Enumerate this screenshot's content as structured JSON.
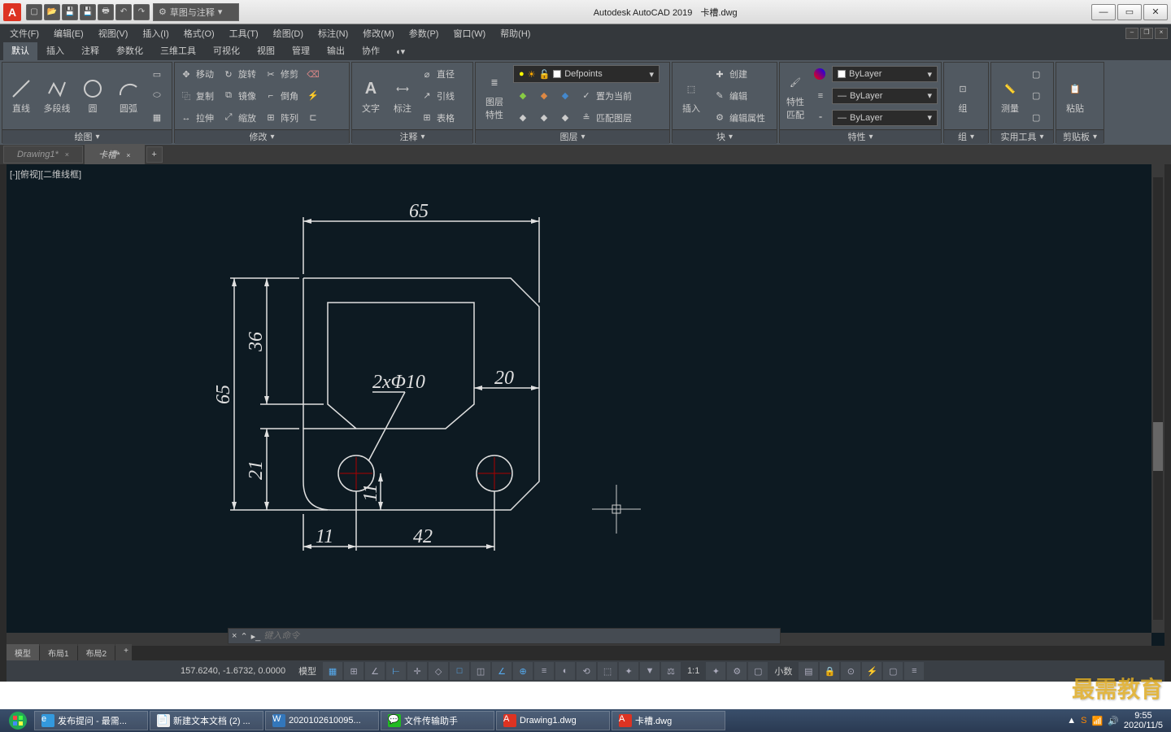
{
  "title": {
    "app": "Autodesk AutoCAD 2019",
    "file": "卡槽.dwg"
  },
  "workspace": "草图与注释",
  "menus": [
    "文件(F)",
    "编辑(E)",
    "视图(V)",
    "插入(I)",
    "格式(O)",
    "工具(T)",
    "绘图(D)",
    "标注(N)",
    "修改(M)",
    "参数(P)",
    "窗口(W)",
    "帮助(H)"
  ],
  "rtabs": [
    "默认",
    "插入",
    "注释",
    "参数化",
    "三维工具",
    "可视化",
    "视图",
    "管理",
    "输出",
    "协作"
  ],
  "panels": {
    "draw": {
      "title": "绘图",
      "items": [
        "直线",
        "多段线",
        "圆",
        "圆弧"
      ]
    },
    "modify": {
      "title": "修改",
      "rows": [
        [
          "移动",
          "旋转",
          "修剪"
        ],
        [
          "复制",
          "镜像",
          "倒角"
        ],
        [
          "拉伸",
          "缩放",
          "阵列"
        ]
      ]
    },
    "annot": {
      "title": "注释",
      "text": "文字",
      "dim": "标注",
      "rows": [
        "直径",
        "引线",
        "表格"
      ]
    },
    "layer": {
      "title": "图层",
      "btn": "图层\n特性",
      "current": "Defpoints",
      "rows": [
        "置为当前",
        "匹配图层"
      ]
    },
    "block": {
      "title": "块",
      "btn": "插入",
      "rows": [
        "创建",
        "编辑",
        "编辑属性"
      ]
    },
    "props": {
      "title": "特性",
      "btn": "特性\n匹配",
      "vals": [
        "ByLayer",
        "ByLayer",
        "ByLayer"
      ]
    },
    "group": {
      "title": "组",
      "btn": "组"
    },
    "util": {
      "title": "实用工具",
      "btn": "测量"
    },
    "clip": {
      "title": "剪贴板",
      "btn": "粘贴"
    }
  },
  "ftabs": [
    {
      "name": "Drawing1*",
      "active": false
    },
    {
      "name": "卡槽*",
      "active": true
    }
  ],
  "viewport": "[-][俯视][二维线框]",
  "dims": {
    "top": "65",
    "left": "65",
    "h36": "36",
    "h21": "21",
    "note": "2xΦ10",
    "w20": "20",
    "w11b": "11",
    "b11": "11",
    "b42": "42"
  },
  "cmd_placeholder": "键入命令",
  "ltabs": [
    "模型",
    "布局1",
    "布局2"
  ],
  "coords": "157.6240, -1.6732, 0.0000",
  "status": {
    "model": "模型",
    "scale": "1:1",
    "decimal": "小数"
  },
  "tasks": [
    "发布提问 - 最需...",
    "新建文本文档 (2) ...",
    "2020102610095...",
    "文件传输助手",
    "Drawing1.dwg",
    "卡槽.dwg"
  ],
  "tray": {
    "time": "9:55",
    "date": "2020/11/5"
  },
  "watermark": "最需教育"
}
